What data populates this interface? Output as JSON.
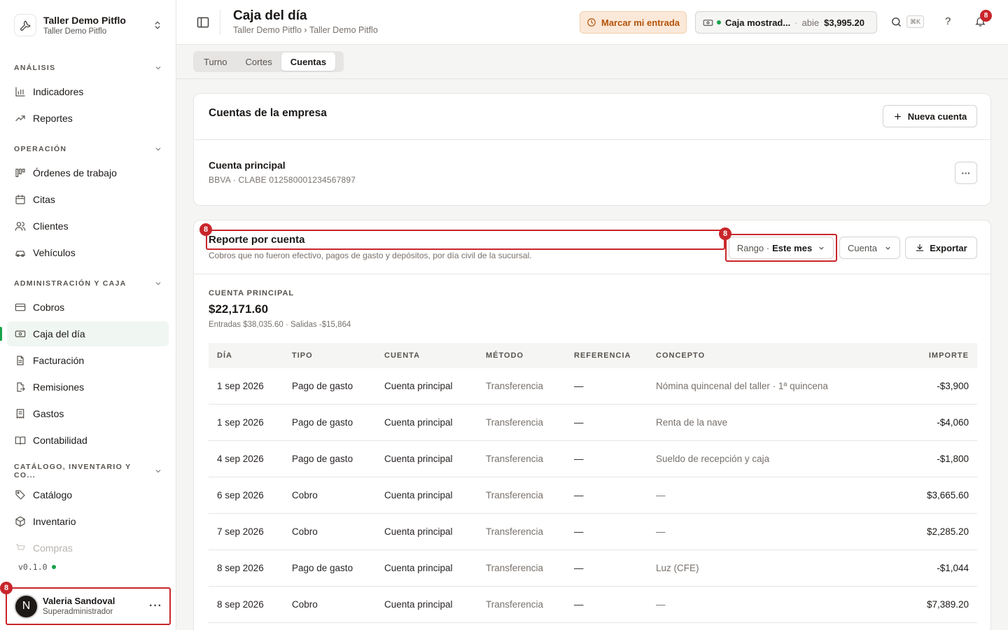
{
  "org": {
    "name": "Taller Demo Pitflo",
    "sub": "Taller Demo Pitflo"
  },
  "sidebar": {
    "sections": [
      {
        "label": "ANÁLISIS",
        "items": [
          {
            "label": "Indicadores",
            "icon": "bar-chart-icon"
          },
          {
            "label": "Reportes",
            "icon": "trend-icon"
          }
        ]
      },
      {
        "label": "OPERACIÓN",
        "items": [
          {
            "label": "Órdenes de trabajo",
            "icon": "kanban-icon"
          },
          {
            "label": "Citas",
            "icon": "calendar-icon"
          },
          {
            "label": "Clientes",
            "icon": "users-icon"
          },
          {
            "label": "Vehículos",
            "icon": "car-icon"
          }
        ]
      },
      {
        "label": "ADMINISTRACIÓN Y CAJA",
        "items": [
          {
            "label": "Cobros",
            "icon": "card-icon"
          },
          {
            "label": "Caja del día",
            "icon": "cash-icon"
          },
          {
            "label": "Facturación",
            "icon": "file-icon"
          },
          {
            "label": "Remisiones",
            "icon": "file-export-icon"
          },
          {
            "label": "Gastos",
            "icon": "receipt-icon"
          },
          {
            "label": "Contabilidad",
            "icon": "book-icon"
          }
        ]
      },
      {
        "label": "CATÁLOGO, INVENTARIO Y CO...",
        "items": [
          {
            "label": "Catálogo",
            "icon": "tag-icon"
          },
          {
            "label": "Inventario",
            "icon": "box-icon"
          },
          {
            "label": "Compras",
            "icon": "cart-icon"
          }
        ]
      }
    ],
    "version": "v0.1.0"
  },
  "user": {
    "name": "Valeria Sandoval",
    "role": "Superadministrador",
    "initial": "N",
    "more": "···"
  },
  "badges": {
    "count": "8"
  },
  "header": {
    "title": "Caja del día",
    "breadcrumb": "Taller Demo Pitflo › Taller Demo Pitflo",
    "checkin_label": "Marcar mi entrada",
    "cash_name": "Caja mostrad...",
    "cash_sep": "·",
    "cash_status": "abie",
    "cash_amount": "$3,995.20",
    "kbd": "⌘K",
    "help": "?",
    "notif_count": "8"
  },
  "tabs": [
    {
      "label": "Turno"
    },
    {
      "label": "Cortes"
    },
    {
      "label": "Cuentas",
      "active": true
    }
  ],
  "accounts_card": {
    "title": "Cuentas de la empresa",
    "new_button": "Nueva cuenta",
    "account_name": "Cuenta principal",
    "account_detail": "BBVA · CLABE 012580001234567897",
    "more": "···"
  },
  "report": {
    "title": "Reporte por cuenta",
    "description": "Cobros que no fueron efectivo, pagos de gasto y depósitos, por día civil de la sucursal.",
    "range_label": "Rango ·",
    "range_value": "Este mes",
    "account_filter": "Cuenta",
    "export": "Exportar",
    "summary_label": "CUENTA PRINCIPAL",
    "summary_total": "$22,171.60",
    "summary_sub": "Entradas $38,035.60 · Salidas -$15,864",
    "columns": [
      "DÍA",
      "TIPO",
      "CUENTA",
      "MÉTODO",
      "REFERENCIA",
      "CONCEPTO",
      "IMPORTE"
    ],
    "rows": [
      [
        "1 sep 2026",
        "Pago de gasto",
        "Cuenta principal",
        "Transferencia",
        "—",
        "Nómina quincenal del taller · 1ª quincena",
        "-$3,900"
      ],
      [
        "1 sep 2026",
        "Pago de gasto",
        "Cuenta principal",
        "Transferencia",
        "—",
        "Renta de la nave",
        "-$4,060"
      ],
      [
        "4 sep 2026",
        "Pago de gasto",
        "Cuenta principal",
        "Transferencia",
        "—",
        "Sueldo de recepción y caja",
        "-$1,800"
      ],
      [
        "6 sep 2026",
        "Cobro",
        "Cuenta principal",
        "Transferencia",
        "—",
        "—",
        "$3,665.60"
      ],
      [
        "7 sep 2026",
        "Cobro",
        "Cuenta principal",
        "Transferencia",
        "—",
        "—",
        "$2,285.20"
      ],
      [
        "8 sep 2026",
        "Pago de gasto",
        "Cuenta principal",
        "Transferencia",
        "—",
        "Luz (CFE)",
        "-$1,044"
      ],
      [
        "8 sep 2026",
        "Cobro",
        "Cuenta principal",
        "Transferencia",
        "—",
        "—",
        "$7,389.20"
      ]
    ]
  },
  "colors": {
    "accent_red": "#c8262b",
    "active_green": "#16a34a",
    "checkin_orange": "#b45309"
  }
}
